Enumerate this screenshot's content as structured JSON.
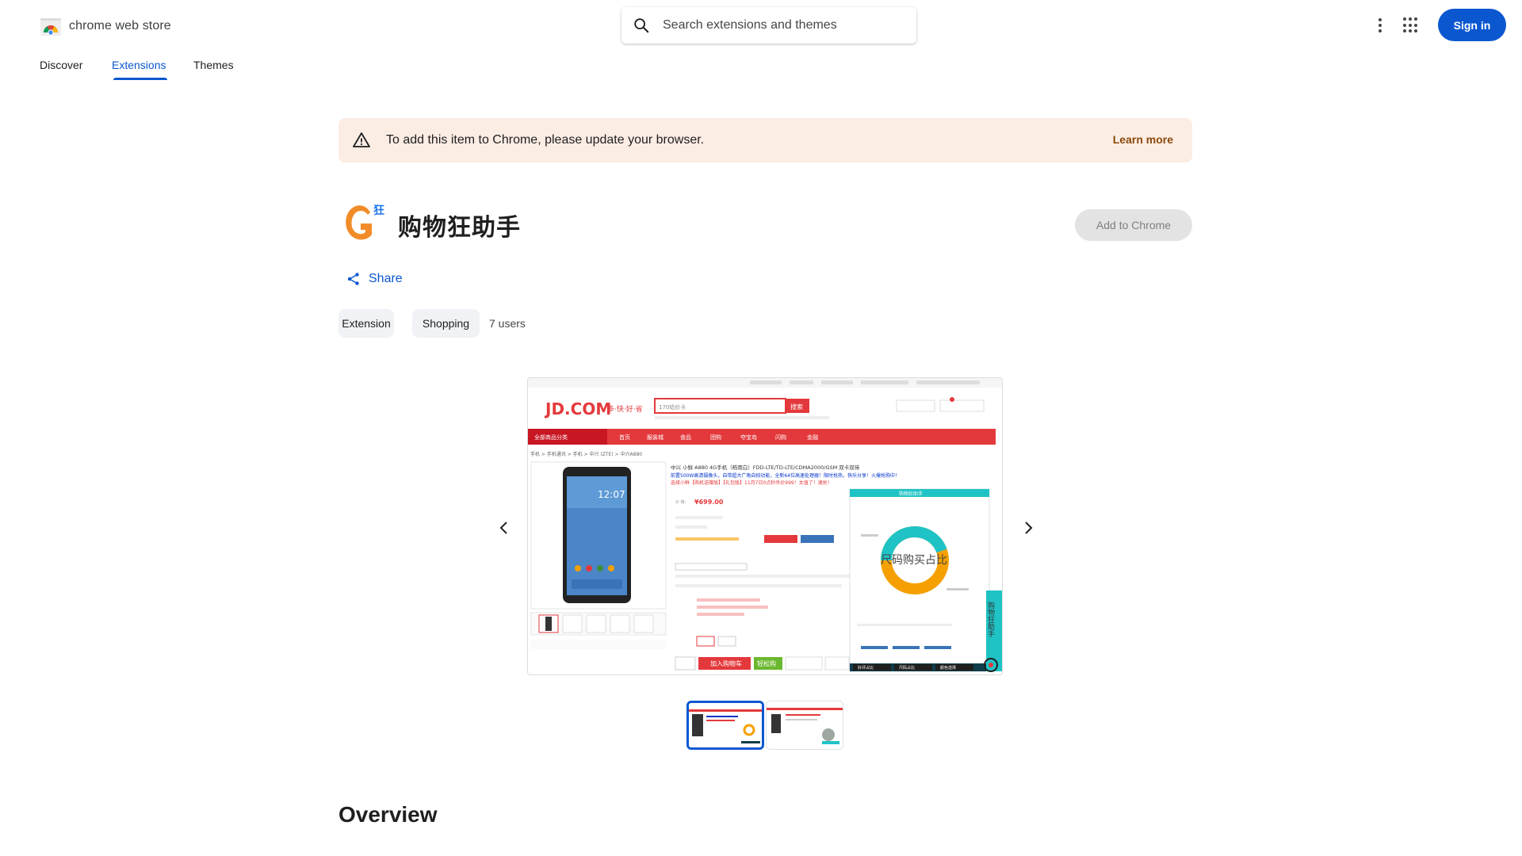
{
  "header": {
    "brand": "chrome web store",
    "search_placeholder": "Search extensions and themes",
    "more_options_icon": "more-vert-icon",
    "apps_icon": "apps-grid-icon",
    "signin_label": "Sign in"
  },
  "tabs": [
    {
      "label": "Discover",
      "active": false
    },
    {
      "label": "Extensions",
      "active": true
    },
    {
      "label": "Themes",
      "active": false
    }
  ],
  "banner": {
    "message": "To add this item to Chrome, please update your browser.",
    "link": "Learn more",
    "icon": "warning-icon"
  },
  "item": {
    "title": "购物狂助手",
    "add_button": "Add to Chrome",
    "share_label": "Share",
    "chips": [
      "Extension",
      "Shopping"
    ],
    "users": "7 users"
  },
  "screenshot": {
    "shop_logo": "JD.COM",
    "shop_slogan": "多·快·好·省",
    "search_value": "170给价卡",
    "search_button": "搜索",
    "nav_items": [
      "全部商品分类",
      "首页",
      "服装城",
      "食品",
      "团购",
      "夺宝岛",
      "闪购",
      "金融"
    ],
    "breadcrumb": "手机 > 手机通讯 > 手机 > 中兴 (ZTE) > 中兴A880",
    "phone_time": "12:07",
    "product_title": "中兴 小鲜 A880 4G手机（皓雨白）FDD-LTE/TD-LTE/CDMA2000/GSM 双卡双待",
    "promo_line1": "前置500W高清摄像头，自带超大广角自拍功能，全新64位高速处理器！限时抢热，快乐分享！火爆抢购中！",
    "promo_line2": "选择小鲜【购机送赠版】【礼包版】11月7日0点秒杀价999！太值了！速抢！",
    "price": "¥699.00",
    "panel_title": "购物狂助手",
    "donut_label": "尺码购买占比",
    "side_tab": "购物狂助手",
    "cart_button": "加入购物车",
    "quick_buy": "轻松购",
    "bottom_tabs": [
      "好评占比",
      "尺码占比",
      "颜色选择"
    ]
  },
  "carousel": {
    "prev_icon": "chevron-left-icon",
    "next_icon": "chevron-right-icon",
    "thumb_count": 2,
    "selected_index": 0
  },
  "overview": {
    "heading": "Overview"
  },
  "colors": {
    "accent": "#0b57d0",
    "banner_bg": "#fbece4",
    "link_brown": "#8a4a0b",
    "jd_red": "#e4393c",
    "donut_teal": "#1fc3c5",
    "donut_orange": "#f5a000"
  }
}
